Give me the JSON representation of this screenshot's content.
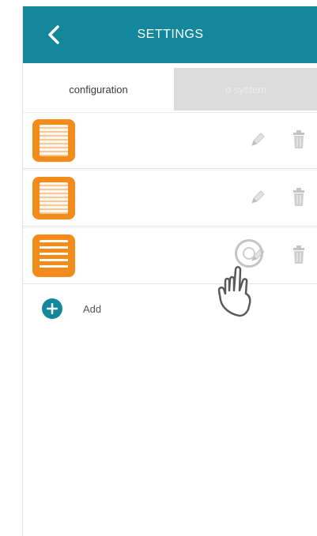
{
  "header": {
    "title": "SETTINGS",
    "back_icon": "chevron-left-icon",
    "color": "#13879b"
  },
  "tabs": [
    {
      "label": "configuration",
      "active": true
    },
    {
      "label": "o system",
      "active": false
    }
  ],
  "items": [
    {
      "name": "",
      "icon": "roller-shade-icon",
      "state": "closed"
    },
    {
      "name": "",
      "icon": "roller-shade-icon",
      "state": "closed"
    },
    {
      "name": "",
      "icon": "roller-shade-icon",
      "state": "open"
    }
  ],
  "actions": {
    "edit_icon": "pencil-icon",
    "delete_icon": "trash-icon"
  },
  "add": {
    "label": "Add",
    "icon": "plus-circle-icon"
  },
  "colors": {
    "accent": "#13879b",
    "shade_icon": "#f48c1c"
  }
}
